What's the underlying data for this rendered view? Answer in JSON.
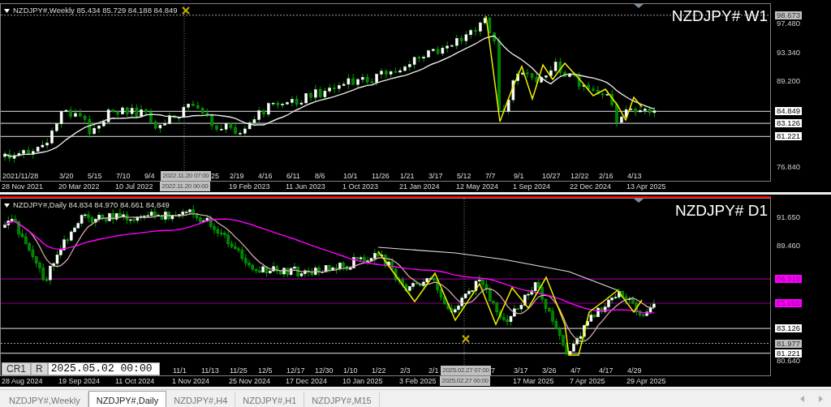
{
  "charts": [
    {
      "header": "NZDJPY#,Weekly 85.434 85.729 84.188 84.849",
      "label": "NZDJPY# W1",
      "active": false,
      "price_labels": [
        {
          "text": "98.673",
          "kind": "current"
        },
        {
          "text": "97.480",
          "kind": "tick"
        },
        {
          "text": "93.340",
          "kind": "tick"
        },
        {
          "text": "89.200",
          "kind": "tick"
        },
        {
          "text": "84.849",
          "kind": "level"
        },
        {
          "text": "83.126",
          "kind": "level"
        },
        {
          "text": "81.221",
          "kind": "level"
        },
        {
          "text": "76.840",
          "kind": "tick"
        }
      ],
      "time_labels_short": [
        {
          "text": "2021/11/28",
          "kind": "date"
        },
        {
          "text": "3/20",
          "kind": "date"
        },
        {
          "text": "5/15",
          "kind": "date"
        },
        {
          "text": "7/10",
          "kind": "date"
        },
        {
          "text": "9/4",
          "kind": "date"
        },
        {
          "text": "2022.11.20 07:00",
          "kind": "crosshair"
        },
        {
          "text": "25",
          "kind": "clipped"
        },
        {
          "text": "2/19",
          "kind": "date"
        },
        {
          "text": "4/16",
          "kind": "date"
        },
        {
          "text": "6/11",
          "kind": "date"
        },
        {
          "text": "8/6",
          "kind": "date"
        },
        {
          "text": "10/1",
          "kind": "date"
        },
        {
          "text": "11/26",
          "kind": "date"
        },
        {
          "text": "1/21",
          "kind": "date"
        },
        {
          "text": "3/17",
          "kind": "date"
        },
        {
          "text": "5/12",
          "kind": "date"
        },
        {
          "text": "7/7",
          "kind": "date"
        },
        {
          "text": "9/1",
          "kind": "date"
        },
        {
          "text": "10/27",
          "kind": "date"
        },
        {
          "text": "12/22",
          "kind": "date"
        },
        {
          "text": "2/16",
          "kind": "date"
        },
        {
          "text": "4/13",
          "kind": "date"
        }
      ],
      "time_labels_long": [
        {
          "text": "28 Nov 2021",
          "kind": "date"
        },
        {
          "text": "20 Mar 2022",
          "kind": "date"
        },
        {
          "text": "10 Jul 2022",
          "kind": "date"
        },
        {
          "text": "2022.11.20 00:00",
          "kind": "crosshair"
        },
        {
          "text": "19 Feb 2023",
          "kind": "date"
        },
        {
          "text": "11 Jun 2023",
          "kind": "date"
        },
        {
          "text": "1 Oct 2023",
          "kind": "date"
        },
        {
          "text": "21 Jan 2024",
          "kind": "date"
        },
        {
          "text": "12 May 2024",
          "kind": "date"
        },
        {
          "text": "1 Sep 2024",
          "kind": "date"
        },
        {
          "text": "22 Dec 2024",
          "kind": "date"
        },
        {
          "text": "13 Apr 2025",
          "kind": "date"
        }
      ]
    },
    {
      "header": "NZDJPY#,Daily 84.834 84.970 84.661 84.849",
      "label": "NZDJPY# D1",
      "active": true,
      "info_box": {
        "buttons": [
          "CR1",
          "R"
        ],
        "date": "2025.05.02 00:00"
      },
      "price_labels": [
        {
          "text": "91.650",
          "kind": "tick"
        },
        {
          "text": "89.460",
          "kind": "tick"
        },
        {
          "text": "86.916",
          "kind": "magenta"
        },
        {
          "text": "85.055",
          "kind": "magenta"
        },
        {
          "text": "83.126",
          "kind": "level"
        },
        {
          "text": "81.977",
          "kind": "current"
        },
        {
          "text": "81.221",
          "kind": "level"
        },
        {
          "text": "80.640",
          "kind": "tick"
        }
      ],
      "time_labels_short": [
        {
          "text": "11/1",
          "kind": "date"
        },
        {
          "text": "11/13",
          "kind": "date"
        },
        {
          "text": "11/25",
          "kind": "date"
        },
        {
          "text": "12/5",
          "kind": "date"
        },
        {
          "text": "12/17",
          "kind": "date"
        },
        {
          "text": "12/30",
          "kind": "date"
        },
        {
          "text": "1/10",
          "kind": "date"
        },
        {
          "text": "1/22",
          "kind": "date"
        },
        {
          "text": "2/3",
          "kind": "date"
        },
        {
          "text": "2/1",
          "kind": "date"
        },
        {
          "text": "2025.02.27 07:00",
          "kind": "crosshair"
        },
        {
          "text": "7",
          "kind": "clipped"
        },
        {
          "text": "3/17",
          "kind": "date"
        },
        {
          "text": "3/26",
          "kind": "date"
        },
        {
          "text": "4/7",
          "kind": "date"
        },
        {
          "text": "4/17",
          "kind": "date"
        },
        {
          "text": "4/29",
          "kind": "date"
        }
      ],
      "time_labels_long": [
        {
          "text": "28 Aug 2024",
          "kind": "date"
        },
        {
          "text": "19 Sep 2024",
          "kind": "date"
        },
        {
          "text": "11 Oct 2024",
          "kind": "date"
        },
        {
          "text": "1 Nov 2024",
          "kind": "date"
        },
        {
          "text": "25 Nov 2024",
          "kind": "date"
        },
        {
          "text": "17 Dec 2024",
          "kind": "date"
        },
        {
          "text": "10 Jan 2025",
          "kind": "date"
        },
        {
          "text": "3 Feb 2025",
          "kind": "date"
        },
        {
          "text": "2025.02.27 00:00",
          "kind": "crosshair"
        },
        {
          "text": "17 Mar 2025",
          "kind": "date"
        },
        {
          "text": "7 Apr 2025",
          "kind": "date"
        },
        {
          "text": "29 Apr 2025",
          "kind": "date"
        }
      ]
    }
  ],
  "tabs": [
    {
      "label": "NZDJPY#,Weekly",
      "selected": false
    },
    {
      "label": "NZDJPY#,Daily",
      "selected": true
    },
    {
      "label": "NZDJPY#,H4",
      "selected": false
    },
    {
      "label": "NZDJPY#,H1",
      "selected": false
    },
    {
      "label": "NZDJPY#,M15",
      "selected": false
    }
  ]
}
